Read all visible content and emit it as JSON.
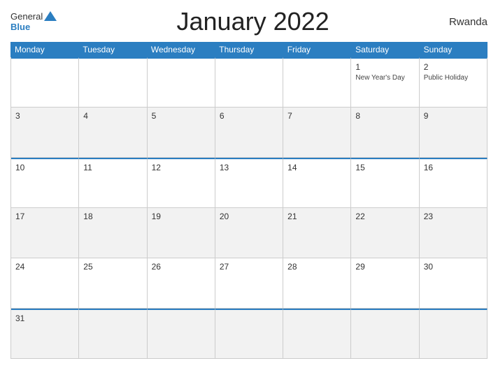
{
  "header": {
    "logo_general": "General",
    "logo_blue": "Blue",
    "title": "January 2022",
    "country": "Rwanda"
  },
  "days_of_week": [
    "Monday",
    "Tuesday",
    "Wednesday",
    "Thursday",
    "Friday",
    "Saturday",
    "Sunday"
  ],
  "weeks": [
    {
      "style": "white",
      "top_border": true,
      "days": [
        {
          "num": "",
          "event": ""
        },
        {
          "num": "",
          "event": ""
        },
        {
          "num": "",
          "event": ""
        },
        {
          "num": "",
          "event": ""
        },
        {
          "num": "",
          "event": ""
        },
        {
          "num": "1",
          "event": "New Year's Day"
        },
        {
          "num": "2",
          "event": "Public Holiday"
        }
      ]
    },
    {
      "style": "gray",
      "top_border": false,
      "days": [
        {
          "num": "3",
          "event": ""
        },
        {
          "num": "4",
          "event": ""
        },
        {
          "num": "5",
          "event": ""
        },
        {
          "num": "6",
          "event": ""
        },
        {
          "num": "7",
          "event": ""
        },
        {
          "num": "8",
          "event": ""
        },
        {
          "num": "9",
          "event": ""
        }
      ]
    },
    {
      "style": "white",
      "top_border": true,
      "days": [
        {
          "num": "10",
          "event": ""
        },
        {
          "num": "11",
          "event": ""
        },
        {
          "num": "12",
          "event": ""
        },
        {
          "num": "13",
          "event": ""
        },
        {
          "num": "14",
          "event": ""
        },
        {
          "num": "15",
          "event": ""
        },
        {
          "num": "16",
          "event": ""
        }
      ]
    },
    {
      "style": "gray",
      "top_border": false,
      "days": [
        {
          "num": "17",
          "event": ""
        },
        {
          "num": "18",
          "event": ""
        },
        {
          "num": "19",
          "event": ""
        },
        {
          "num": "20",
          "event": ""
        },
        {
          "num": "21",
          "event": ""
        },
        {
          "num": "22",
          "event": ""
        },
        {
          "num": "23",
          "event": ""
        }
      ]
    },
    {
      "style": "white",
      "top_border": false,
      "days": [
        {
          "num": "24",
          "event": ""
        },
        {
          "num": "25",
          "event": ""
        },
        {
          "num": "26",
          "event": ""
        },
        {
          "num": "27",
          "event": ""
        },
        {
          "num": "28",
          "event": ""
        },
        {
          "num": "29",
          "event": ""
        },
        {
          "num": "30",
          "event": ""
        }
      ]
    },
    {
      "style": "gray",
      "top_border": true,
      "days": [
        {
          "num": "31",
          "event": ""
        },
        {
          "num": "",
          "event": ""
        },
        {
          "num": "",
          "event": ""
        },
        {
          "num": "",
          "event": ""
        },
        {
          "num": "",
          "event": ""
        },
        {
          "num": "",
          "event": ""
        },
        {
          "num": "",
          "event": ""
        }
      ]
    }
  ]
}
